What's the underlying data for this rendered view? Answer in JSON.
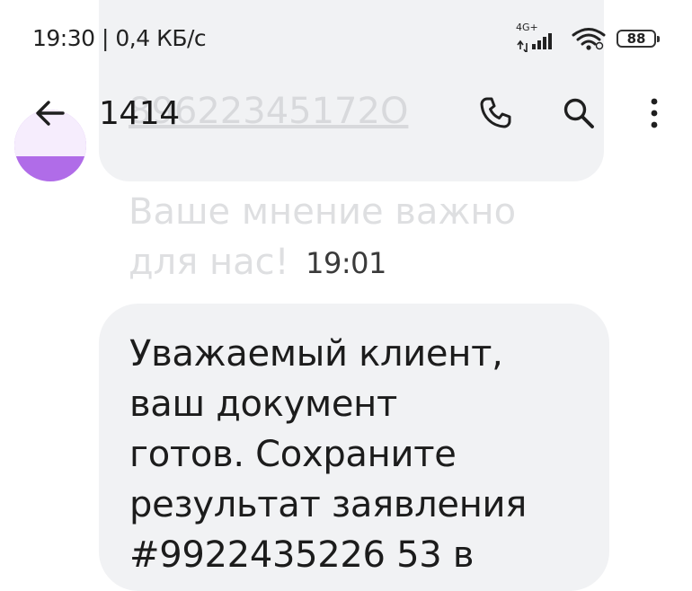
{
  "previous_message": {
    "link_top": "............",
    "link_number": "89622345172O",
    "text": "Ваше мнение важно\nдля нас!"
  },
  "status_bar": {
    "time_speed": "19:30 | 0,4 КБ/с",
    "network_type": "4G+",
    "battery_level": "88"
  },
  "toolbar": {
    "back_icon": "arrow-left-icon",
    "title": "1414",
    "call_icon": "phone-icon",
    "search_icon": "magnifier-icon",
    "menu_icon": "more-vertical-icon"
  },
  "conversation": {
    "timestamp": "19:01",
    "message": "Уважаемый клиент,\nваш документ\nготов. Сохраните\nрезультат заявления\n#9922435226 53 в"
  },
  "colors": {
    "bubble": "#f1f2f4",
    "avatar": "#b06ce8",
    "text": "#1c1c1c"
  }
}
